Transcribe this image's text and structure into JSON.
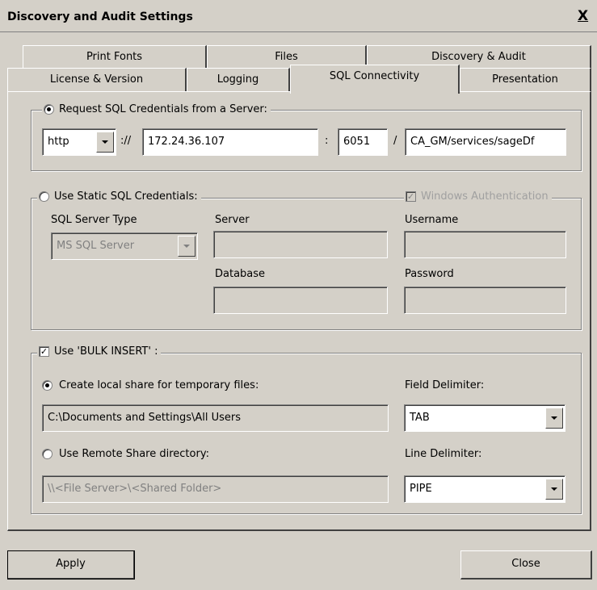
{
  "window": {
    "title": "Discovery and Audit Settings",
    "close_glyph": "X"
  },
  "tabs_row_back": [
    {
      "label": "Print Fonts"
    },
    {
      "label": "Files"
    },
    {
      "label": "Discovery & Audit"
    }
  ],
  "tabs_row_front": [
    {
      "label": "License & Version"
    },
    {
      "label": "Logging"
    },
    {
      "label": "SQL Connectivity",
      "active": true
    },
    {
      "label": "Presentation"
    }
  ],
  "request_group": {
    "label": "Request SQL Credentials from a Server:",
    "selected": true,
    "protocol": "http",
    "scheme_sep": "://",
    "host": "172.24.36.107",
    "port_sep": ":",
    "port": "6051",
    "path_sep": "/",
    "path": "CA_GM/services/sageDf"
  },
  "static_group": {
    "label": "Use Static SQL Credentials:",
    "selected": false,
    "windows_auth_label": "Windows Authentication",
    "windows_auth_checked": true,
    "server_type_label": "SQL Server Type",
    "server_type_value": "MS SQL Server",
    "server_label": "Server",
    "server_value": "",
    "username_label": "Username",
    "username_value": "",
    "database_label": "Database",
    "database_value": "",
    "password_label": "Password",
    "password_value": ""
  },
  "bulk_group": {
    "label": "Use 'BULK INSERT' :",
    "checked": true,
    "local_share_label": "Create local share for temporary files:",
    "local_share_selected": true,
    "local_share_path": "C:\\Documents and Settings\\All Users",
    "field_delim_label": "Field Delimiter:",
    "field_delim_value": "TAB",
    "remote_share_label": "Use Remote Share directory:",
    "remote_share_selected": false,
    "remote_share_path": "\\\\<File Server>\\<Shared Folder>",
    "line_delim_label": "Line Delimiter:",
    "line_delim_value": "PIPE"
  },
  "buttons": {
    "apply": "Apply",
    "close": "Close"
  }
}
